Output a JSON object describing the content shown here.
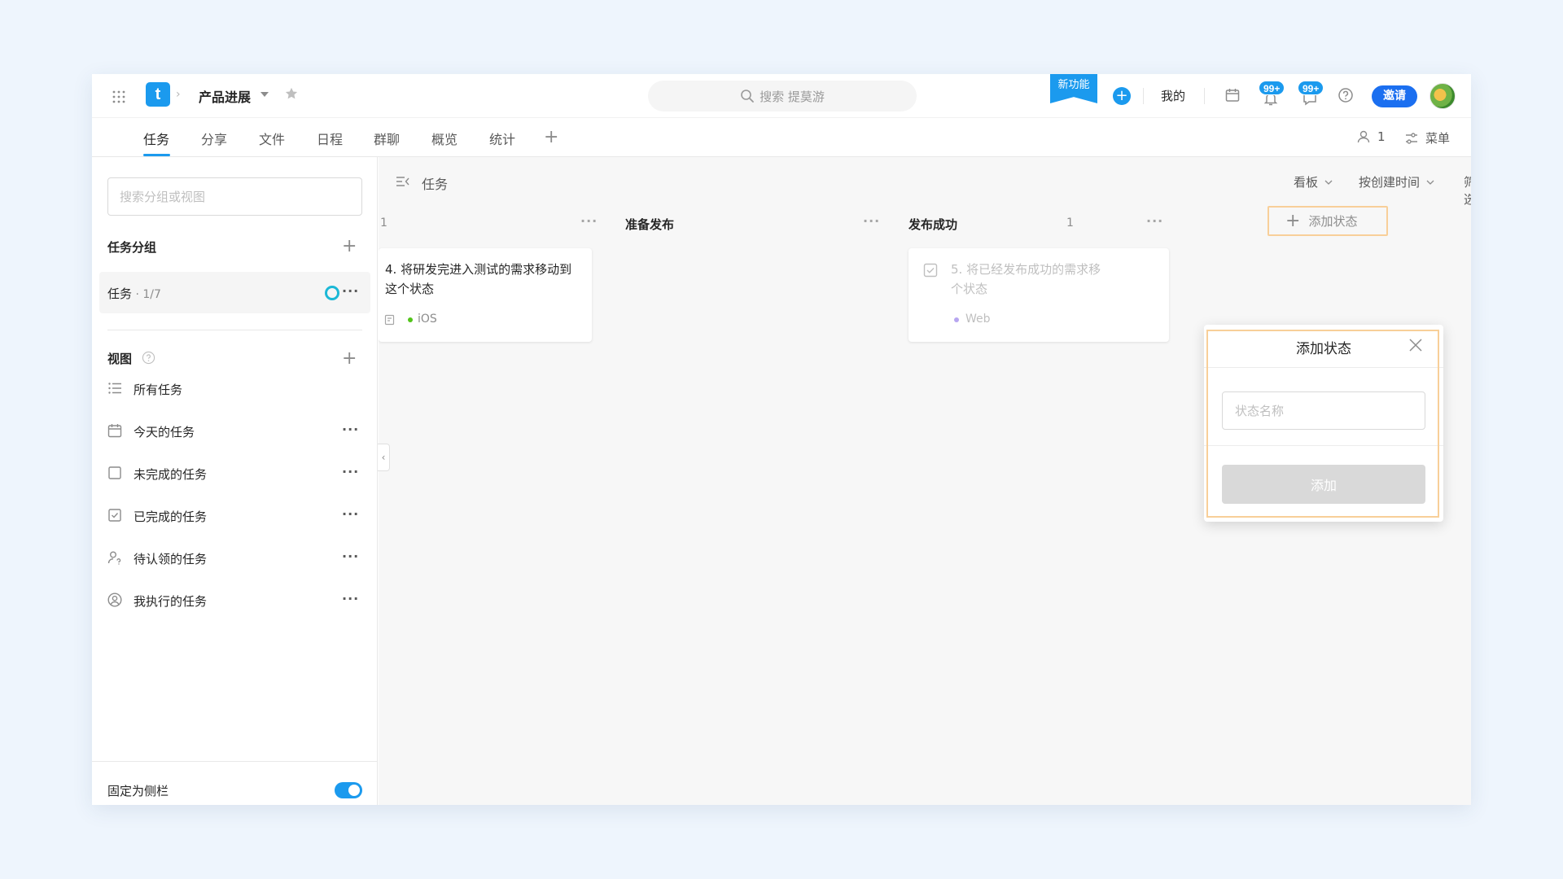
{
  "header": {
    "project_name": "产品进展",
    "search_text": "搜索 提莫游",
    "new_feature_label": "新功能",
    "mine_label": "我的",
    "notification_badge": "99+",
    "message_badge": "99+",
    "invite_label": "邀请",
    "logo_letter": "t"
  },
  "tabs": [
    {
      "label": "任务"
    },
    {
      "label": "分享"
    },
    {
      "label": "文件"
    },
    {
      "label": "日程"
    },
    {
      "label": "群聊"
    },
    {
      "label": "概览"
    },
    {
      "label": "统计"
    }
  ],
  "tab_right": {
    "member_count": "1",
    "menu_label": "菜单"
  },
  "sidebar": {
    "search_placeholder": "搜索分组或视图",
    "groups_heading": "任务分组",
    "group_item": {
      "label": "任务",
      "count": " · 1/7"
    },
    "views_heading": "视图",
    "views": [
      {
        "label": "所有任务"
      },
      {
        "label": "今天的任务"
      },
      {
        "label": "未完成的任务"
      },
      {
        "label": "已完成的任务"
      },
      {
        "label": "待认领的任务"
      },
      {
        "label": "我执行的任务"
      }
    ],
    "pin_label": "固定为侧栏"
  },
  "board": {
    "title": "任务",
    "controls": {
      "view": "看板",
      "sort": "按创建时间",
      "filter": "筛选"
    },
    "columns": [
      {
        "name": "",
        "count": "1"
      },
      {
        "name": "准备发布",
        "count": ""
      },
      {
        "name": "发布成功",
        "count": "1"
      }
    ],
    "cards": [
      {
        "line1": "4. 将研发完进入测试的需求移动到",
        "line2": "这个状态",
        "tag": "iOS",
        "tag_color": "#52c41a"
      },
      {
        "line1": "5. 将已经发布成功的需求移",
        "line2": "个状态",
        "tag": "Web",
        "tag_color": "#b7a6f0"
      }
    ],
    "add_status_label": "添加状态"
  },
  "popup": {
    "title": "添加状态",
    "input_placeholder": "状态名称",
    "button_label": "添加"
  },
  "colors": {
    "accent": "#1b9aee",
    "highlight": "#f8cf99"
  }
}
